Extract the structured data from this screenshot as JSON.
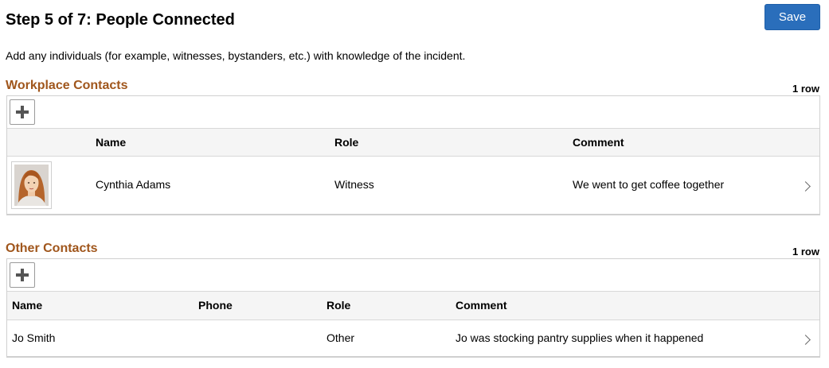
{
  "header": {
    "title": "Step 5 of 7: People Connected",
    "save_label": "Save"
  },
  "instructions": "Add any individuals (for example, witnesses, bystanders, etc.) with knowledge of the incident.",
  "workplace_contacts": {
    "title": "Workplace Contacts",
    "row_count": "1 row",
    "add_icon": "plus-icon",
    "columns": {
      "name": "Name",
      "role": "Role",
      "comment": "Comment"
    },
    "rows": [
      {
        "name": "Cynthia Adams",
        "role": "Witness",
        "comment": "We went to get coffee together",
        "avatar": "person-photo"
      }
    ]
  },
  "other_contacts": {
    "title": "Other Contacts",
    "row_count": "1 row",
    "add_icon": "plus-icon",
    "columns": {
      "name": "Name",
      "phone": "Phone",
      "role": "Role",
      "comment": "Comment"
    },
    "rows": [
      {
        "name": "Jo Smith",
        "phone": "",
        "role": "Other",
        "comment": "Jo was stocking pantry supplies when it happened"
      }
    ]
  },
  "colors": {
    "accent": "#2a6ebb",
    "section_title": "#a0561c"
  },
  "row_icon": "chevron-right-icon"
}
